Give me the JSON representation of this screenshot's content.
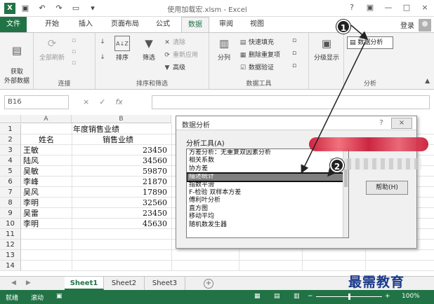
{
  "titlebar": {
    "file_name": "使用加载宏.xlsm - Excel",
    "help": "?",
    "minimize": "—",
    "restore": "□",
    "close": "×"
  },
  "tabs": [
    {
      "label": "文件"
    },
    {
      "label": "开始"
    },
    {
      "label": "插入"
    },
    {
      "label": "页面布局"
    },
    {
      "label": "公式"
    },
    {
      "label": "数据"
    },
    {
      "label": "审阅"
    },
    {
      "label": "视图"
    }
  ],
  "active_tab": "数据",
  "login": "登录",
  "ribbon": {
    "get_data": "获取\n外部数据",
    "refresh_all": "全部刷新",
    "connections_group": "连接",
    "sort_az": "A↓Z",
    "sort": "排序",
    "filter": "筛选",
    "clear": "清除",
    "reapply": "重新应用",
    "advanced": "高级",
    "sort_filter_group": "排序和筛选",
    "text_to_columns": "分列",
    "flash_fill": "快速填充",
    "remove_dup": "删除重复项",
    "data_validation": "数据验证",
    "data_tools_group": "数据工具",
    "outline": "分级显示",
    "data_analysis": "数据分析",
    "analysis_group": "分析"
  },
  "formula_bar": {
    "name_box": "B16",
    "cancel": "×",
    "enter": "✓",
    "fx": "fx"
  },
  "columns": [
    "A",
    "B"
  ],
  "sheet": {
    "title": "年度销售业绩",
    "headers": [
      "姓名",
      "销售业绩"
    ],
    "rows": [
      {
        "name": "王敏",
        "value": "23450"
      },
      {
        "name": "陆风",
        "value": "34560"
      },
      {
        "name": "吴敏",
        "value": "59870"
      },
      {
        "name": "李峰",
        "value": "21870"
      },
      {
        "name": "吴风",
        "value": "17890"
      },
      {
        "name": "李明",
        "value": "32560"
      },
      {
        "name": "吴雷",
        "value": "23450"
      },
      {
        "name": "李明",
        "value": "45630"
      }
    ],
    "row_numbers": [
      "1",
      "2",
      "3",
      "4",
      "5",
      "6",
      "7",
      "8",
      "9",
      "10",
      "11",
      "12",
      "13",
      "14"
    ]
  },
  "sheet_tabs": [
    "Sheet1",
    "Sheet2",
    "Sheet3"
  ],
  "active_sheet": "Sheet1",
  "add_sheet": "+",
  "status": {
    "ready": "就绪",
    "scroll": "滚动",
    "zoom": "100%"
  },
  "dialog": {
    "title": "数据分析",
    "help": "?",
    "close": "×",
    "label": "分析工具(A)",
    "items": [
      "方差分析：无重复双因素分析",
      "相关系数",
      "协方差",
      "描述统计",
      "指数平滑",
      "F-检验 双样本方差",
      "傅利叶分析",
      "直方图",
      "移动平均",
      "随机数发生器"
    ],
    "selected_index": 3,
    "help_button": "帮助(H)"
  },
  "callouts": [
    "1",
    "2"
  ],
  "watermark": "最需教育"
}
